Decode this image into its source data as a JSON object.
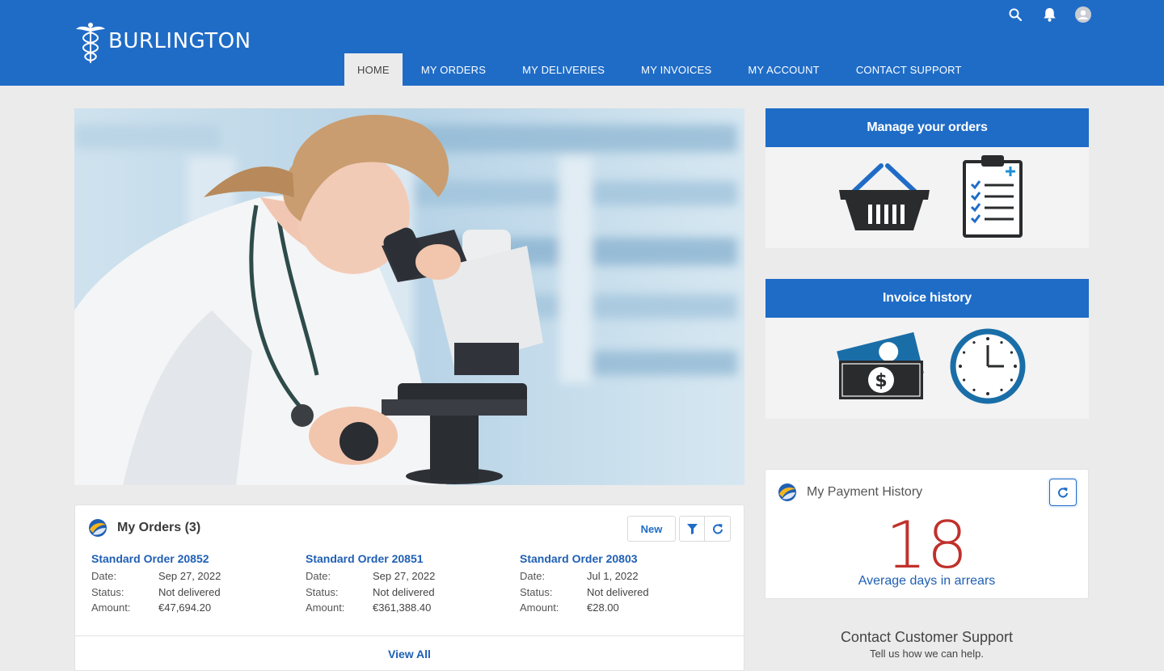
{
  "header": {
    "brand": "BURLINGTON",
    "nav": [
      {
        "label": "HOME",
        "active": true
      },
      {
        "label": "MY ORDERS"
      },
      {
        "label": "MY DELIVERIES"
      },
      {
        "label": "MY INVOICES"
      },
      {
        "label": "MY ACCOUNT"
      },
      {
        "label": "CONTACT SUPPORT"
      }
    ],
    "icons": [
      "search-icon",
      "bell-icon",
      "user-avatar-icon"
    ]
  },
  "hero": {
    "image": "scientist-with-microscope"
  },
  "tiles": {
    "orders": {
      "title": "Manage your orders",
      "icons": [
        "shopping-basket-icon",
        "clipboard-checklist-icon"
      ]
    },
    "invoices": {
      "title": "Invoice history",
      "icons": [
        "money-bills-icon",
        "clock-icon"
      ]
    }
  },
  "orders_card": {
    "title": "My Orders (3)",
    "new_label": "New",
    "view_all": "View All",
    "labels": {
      "date": "Date:",
      "status": "Status:",
      "amount": "Amount:"
    },
    "items": [
      {
        "title": "Standard Order 20852",
        "date": "Sep 27, 2022",
        "status": "Not delivered",
        "amount": "€47,694.20"
      },
      {
        "title": "Standard Order 20851",
        "date": "Sep 27, 2022",
        "status": "Not delivered",
        "amount": "€361,388.40"
      },
      {
        "title": "Standard Order 20803",
        "date": "Jul 1, 2022",
        "status": "Not delivered",
        "amount": "€28.00"
      }
    ]
  },
  "payment_card": {
    "title": "My Payment History",
    "value": "18",
    "label": "Average days in arrears"
  },
  "support": {
    "title": "Contact Customer Support",
    "subtitle": "Tell us how we can help."
  },
  "colors": {
    "primary": "#1f6cc7",
    "link": "#1f5fb4",
    "metric": "#c0312b",
    "background": "#ebebeb"
  }
}
